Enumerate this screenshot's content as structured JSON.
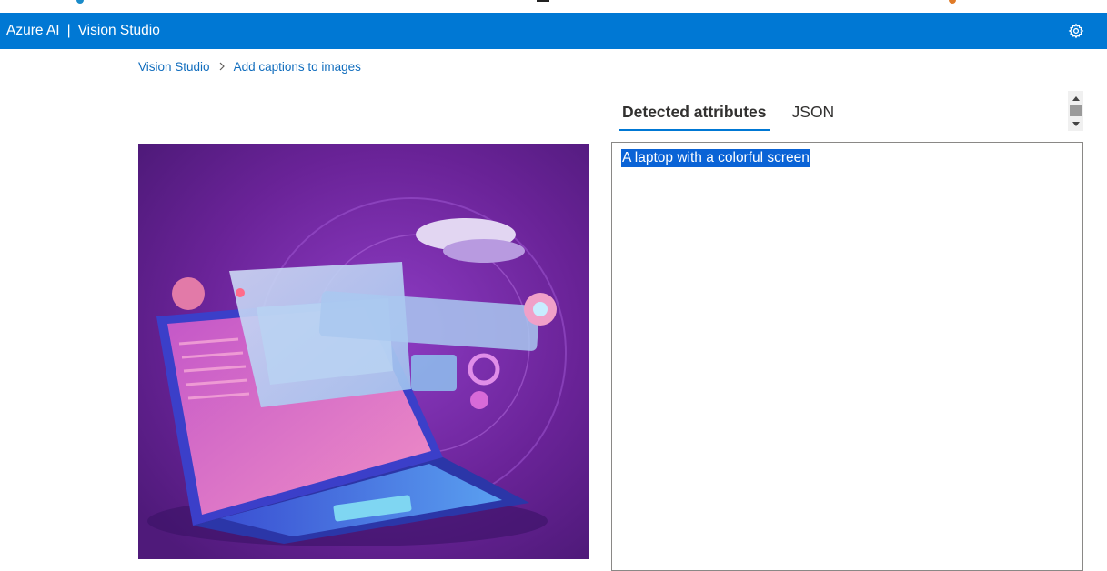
{
  "header": {
    "brand": "Azure AI",
    "product": "Vision Studio",
    "separator": "|",
    "settings_icon": "gear-icon",
    "background": "#0078d4"
  },
  "breadcrumb": {
    "items": [
      "Vision Studio",
      "Add captions to images"
    ]
  },
  "tabs": [
    {
      "label": "Detected attributes",
      "active": true
    },
    {
      "label": "JSON",
      "active": false
    }
  ],
  "result": {
    "caption": "A laptop with a colorful screen"
  },
  "image": {
    "description_icon": "laptop-illustration"
  },
  "colors": {
    "accent": "#0078d4",
    "link": "#0f6cbd",
    "selection": "#0a63d6",
    "image_bg": "#6b2a9e"
  }
}
